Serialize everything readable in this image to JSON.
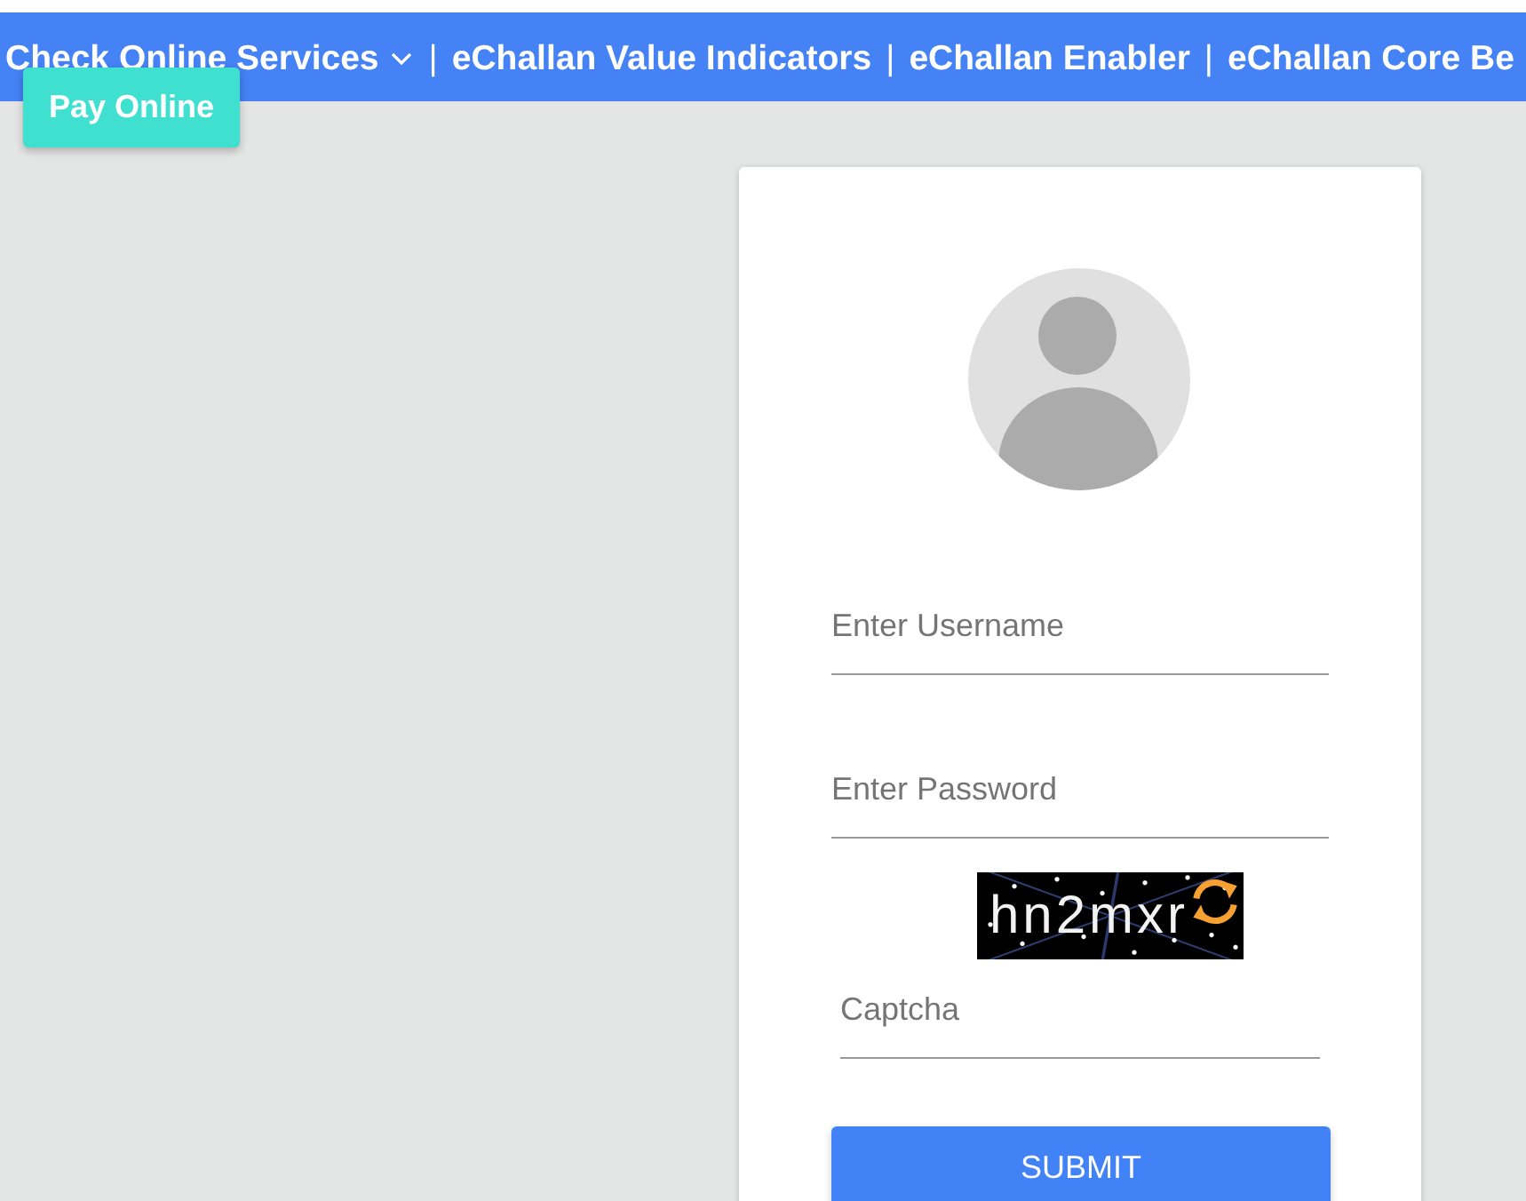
{
  "nav": {
    "items": [
      {
        "kind": "menu",
        "label": "Check Online Services",
        "dropdown": true,
        "dropdown_items": [
          {
            "label": "Pay Online"
          }
        ]
      },
      {
        "kind": "separator",
        "label": "|"
      },
      {
        "kind": "link",
        "label": "eChallan Value Indicators"
      },
      {
        "kind": "separator",
        "label": "|"
      },
      {
        "kind": "link",
        "label": "eChallan Enabler"
      },
      {
        "kind": "separator",
        "label": "|"
      },
      {
        "kind": "link",
        "label": "eChallan Core Be"
      }
    ]
  },
  "login_form": {
    "username": {
      "placeholder": "Enter Username"
    },
    "password": {
      "placeholder": "Enter Password"
    },
    "captcha": {
      "code": "hn2mxr",
      "placeholder": "Captcha"
    },
    "submit": {
      "label": "SUBMIT"
    }
  }
}
